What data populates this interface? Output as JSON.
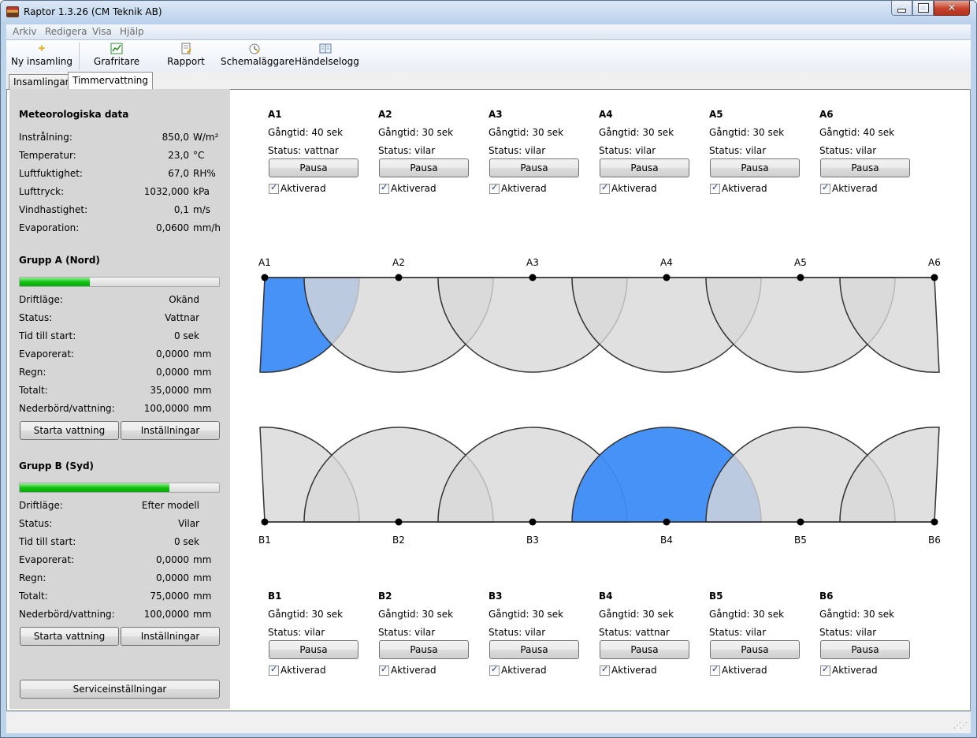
{
  "window": {
    "title": "Raptor 1.3.26 (CM Teknik AB)"
  },
  "menu": [
    "Arkiv",
    "Redigera",
    "Visa",
    "Hjälp"
  ],
  "toolbar": {
    "new": "Ny insamling",
    "graph": "Grafritare",
    "report": "Rapport",
    "scheduler": "Schemaläggare",
    "log": "Händelselogg"
  },
  "tabs": [
    "Insamlingar",
    "Timmervattning"
  ],
  "meteo": {
    "title": "Meteorologiska data",
    "rows": [
      {
        "label": "Instrålning:",
        "value": "850,0",
        "unit": "W/m²"
      },
      {
        "label": "Temperatur:",
        "value": "23,0",
        "unit": "°C"
      },
      {
        "label": "Luftfuktighet:",
        "value": "67,0",
        "unit": "RH%"
      },
      {
        "label": "Lufttryck:",
        "value": "1032,000",
        "unit": "kPa"
      },
      {
        "label": "Vindhastighet:",
        "value": "0,1",
        "unit": "m/s"
      },
      {
        "label": "Evaporation:",
        "value": "0,0600",
        "unit": "mm/h"
      }
    ]
  },
  "groupA": {
    "title": "Grupp A (Nord)",
    "progress": 0.35,
    "rows": [
      {
        "label": "Driftläge:",
        "value": "Okänd",
        "unit": ""
      },
      {
        "label": "Status:",
        "value": "Vattnar",
        "unit": ""
      },
      {
        "label": "Tid till start:",
        "value": "0 sek",
        "unit": ""
      },
      {
        "label": "Evaporerat:",
        "value": "0,0000",
        "unit": "mm"
      },
      {
        "label": "Regn:",
        "value": "0,0000",
        "unit": "mm"
      },
      {
        "label": "Totalt:",
        "value": "35,0000",
        "unit": "mm"
      },
      {
        "label": "Nederbörd/vattning:",
        "value": "100,0000",
        "unit": "mm"
      }
    ],
    "start_label": "Starta vattning",
    "settings_label": "Inställningar"
  },
  "groupB": {
    "title": "Grupp B (Syd)",
    "progress": 0.75,
    "rows": [
      {
        "label": "Driftläge:",
        "value": "Efter modell",
        "unit": ""
      },
      {
        "label": "Status:",
        "value": "Vilar",
        "unit": ""
      },
      {
        "label": "Tid till start:",
        "value": "0 sek",
        "unit": ""
      },
      {
        "label": "Evaporerat:",
        "value": "0,0000",
        "unit": "mm"
      },
      {
        "label": "Regn:",
        "value": "0,0000",
        "unit": "mm"
      },
      {
        "label": "Totalt:",
        "value": "75,0000",
        "unit": "mm"
      },
      {
        "label": "Nederbörd/vattning:",
        "value": "100,0000",
        "unit": "mm"
      }
    ],
    "start_label": "Starta vattning",
    "settings_label": "Inställningar"
  },
  "service_label": "Serviceinställningar",
  "zonesA": [
    {
      "name": "A1",
      "runtime": "Gångtid: 40 sek",
      "status": "Status: vattnar",
      "active": true
    },
    {
      "name": "A2",
      "runtime": "Gångtid: 30 sek",
      "status": "Status: vilar",
      "active": false
    },
    {
      "name": "A3",
      "runtime": "Gångtid: 30 sek",
      "status": "Status: vilar",
      "active": false
    },
    {
      "name": "A4",
      "runtime": "Gångtid: 30 sek",
      "status": "Status: vilar",
      "active": false
    },
    {
      "name": "A5",
      "runtime": "Gångtid: 30 sek",
      "status": "Status: vilar",
      "active": false
    },
    {
      "name": "A6",
      "runtime": "Gångtid: 40 sek",
      "status": "Status: vilar",
      "active": false
    }
  ],
  "zonesB": [
    {
      "name": "B1",
      "runtime": "Gångtid: 30 sek",
      "status": "Status: vilar",
      "active": false
    },
    {
      "name": "B2",
      "runtime": "Gångtid: 30 sek",
      "status": "Status: vilar",
      "active": false
    },
    {
      "name": "B3",
      "runtime": "Gångtid: 30 sek",
      "status": "Status: vilar",
      "active": false
    },
    {
      "name": "B4",
      "runtime": "Gångtid: 30 sek",
      "status": "Status: vattnar",
      "active": true
    },
    {
      "name": "B5",
      "runtime": "Gångtid: 30 sek",
      "status": "Status: vilar",
      "active": false
    },
    {
      "name": "B6",
      "runtime": "Gångtid: 30 sek",
      "status": "Status: vilar",
      "active": false
    }
  ],
  "pause_label": "Pausa",
  "enabled_label": "Aktiverad",
  "colors": {
    "active": "#3d8cf5",
    "idle": "#d8d8d8",
    "overlap": "#b4b4b4",
    "stroke": "#333333"
  }
}
